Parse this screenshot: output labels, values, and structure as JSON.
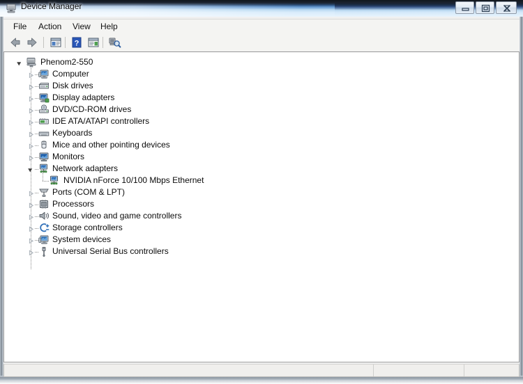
{
  "window": {
    "title": "Device Manager",
    "title_icon": "device-manager-icon",
    "controls": {
      "minimize": "Minimize",
      "maximize": "Maximize",
      "close": "Close"
    }
  },
  "menubar": {
    "items": [
      {
        "label": "File"
      },
      {
        "label": "Action"
      },
      {
        "label": "View"
      },
      {
        "label": "Help"
      }
    ]
  },
  "toolbar": {
    "items": [
      {
        "name": "back-arrow-icon",
        "title": "Back"
      },
      {
        "name": "forward-arrow-icon",
        "title": "Forward"
      },
      {
        "name": "show-hide-console-tree-icon",
        "title": "Show/Hide Console Tree"
      },
      {
        "name": "help-icon",
        "title": "Help"
      },
      {
        "name": "properties-icon",
        "title": "Properties"
      },
      {
        "name": "scan-for-hardware-changes-icon",
        "title": "Scan for hardware changes"
      }
    ]
  },
  "tree": {
    "root": {
      "label": "Phenom2-550",
      "icon": "computer-root-icon",
      "expanded": true
    },
    "nodes": [
      {
        "label": "Computer",
        "icon": "computer-icon",
        "expanded": false,
        "level": 1
      },
      {
        "label": "Disk drives",
        "icon": "disk-drive-icon",
        "expanded": false,
        "level": 1
      },
      {
        "label": "Display adapters",
        "icon": "display-adapter-icon",
        "expanded": false,
        "level": 1
      },
      {
        "label": "DVD/CD-ROM drives",
        "icon": "dvd-drive-icon",
        "expanded": false,
        "level": 1
      },
      {
        "label": "IDE ATA/ATAPI controllers",
        "icon": "ide-controller-icon",
        "expanded": false,
        "level": 1
      },
      {
        "label": "Keyboards",
        "icon": "keyboard-icon",
        "expanded": false,
        "level": 1
      },
      {
        "label": "Mice and other pointing devices",
        "icon": "mouse-icon",
        "expanded": false,
        "level": 1
      },
      {
        "label": "Monitors",
        "icon": "monitor-icon",
        "expanded": false,
        "level": 1
      },
      {
        "label": "Network adapters",
        "icon": "network-adapter-icon",
        "expanded": true,
        "level": 1
      },
      {
        "label": "NVIDIA nForce 10/100 Mbps Ethernet",
        "icon": "network-adapter-icon",
        "expanded": null,
        "level": 2
      },
      {
        "label": "Ports (COM & LPT)",
        "icon": "port-icon",
        "expanded": false,
        "level": 1
      },
      {
        "label": "Processors",
        "icon": "processor-icon",
        "expanded": false,
        "level": 1
      },
      {
        "label": "Sound, video and game controllers",
        "icon": "sound-controller-icon",
        "expanded": false,
        "level": 1
      },
      {
        "label": "Storage controllers",
        "icon": "storage-controller-icon",
        "expanded": false,
        "level": 1
      },
      {
        "label": "System devices",
        "icon": "system-device-icon",
        "expanded": false,
        "level": 1
      },
      {
        "label": "Universal Serial Bus controllers",
        "icon": "usb-controller-icon",
        "expanded": false,
        "level": 1
      }
    ]
  },
  "statusbar": {
    "pane1": "",
    "pane2": "",
    "pane3": ""
  },
  "colors": {
    "titlebar_dark": "#11161d",
    "titlebar_light": "#d9ecfb",
    "content_bg": "#ffffff",
    "chrome_bg": "#f4f4f2",
    "statusbar_bg": "#f0efed",
    "text": "#0b0b0b",
    "help_blue": "#2a57b8"
  }
}
